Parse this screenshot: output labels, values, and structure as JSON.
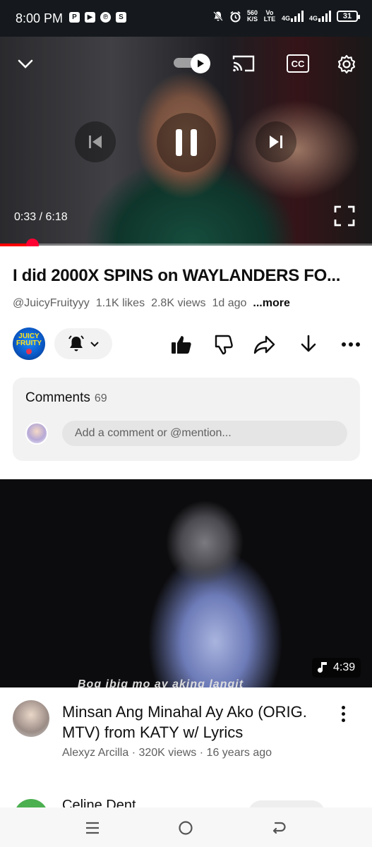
{
  "status_bar": {
    "time": "8:00 PM",
    "app_icons": [
      "P",
      "▶",
      "℗",
      "S"
    ],
    "net_speed_value": "560",
    "net_speed_unit": "K/S",
    "volte": "Vo LTE",
    "net1": "4G",
    "net2": "4G",
    "battery": "31"
  },
  "player": {
    "time_readout": "0:33 / 6:18",
    "progress_fraction": 0.088,
    "icons": {
      "collapse": "chevron-down-icon",
      "autoplay": "autoplay-toggle",
      "cast": "cast-icon",
      "captions": "closed-captions-icon",
      "settings": "gear-icon",
      "previous": "skip-previous-icon",
      "pause": "pause-icon",
      "next": "skip-next-icon",
      "fullscreen": "fullscreen-icon"
    },
    "captions_label": "CC"
  },
  "video": {
    "title": "I did 2000X SPINS on WAYLANDERS FO...",
    "channel": "@JuicyFruityyy",
    "likes": "1.1K likes",
    "views": "2.8K views",
    "age": "1d ago",
    "more_label": "...more",
    "avatar_text_1": "JUICY",
    "avatar_text_2": "FRUITY"
  },
  "comments": {
    "label": "Comments",
    "count": "69",
    "placeholder": "Add a comment or @mention..."
  },
  "next_video": {
    "thumbnail_caption": "Bog ibig mo ay aking langit",
    "duration": "4:39",
    "title": "Minsan Ang Minahal Ay Ako (ORIG. MTV) from KATY w/ Lyrics",
    "channel": "Alexyz Arcilla",
    "views": "320K views",
    "age": "16 years ago",
    "separator": "·"
  },
  "peek_video": {
    "channel_title": "Celine Dent"
  },
  "colors": {
    "accent": "#ff0000",
    "status_bar_bg": "#15191d",
    "card_bg": "#f2f2f2"
  }
}
